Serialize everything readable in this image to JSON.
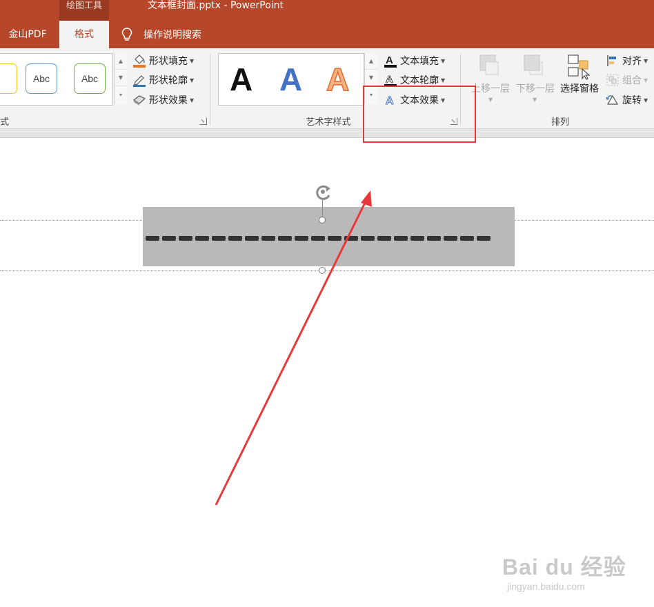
{
  "titlebar": {
    "context_tab_header": "绘图工具",
    "window_title": "文本框封面.pptx  -  PowerPoint"
  },
  "tabs": [
    {
      "label": "金山PDF"
    },
    {
      "label": "格式",
      "active": true
    }
  ],
  "tell_me": {
    "label": "操作说明搜索",
    "icon": "lightbulb-icon"
  },
  "ribbon": {
    "shape_styles": {
      "gallery_items": [
        {
          "label": "Abc",
          "outline": "#5b9bd5"
        },
        {
          "label": "Abc",
          "outline": "#70ad47"
        }
      ],
      "commands": [
        {
          "label": "形状填充",
          "icon": "paint-bucket-icon"
        },
        {
          "label": "形状轮廓",
          "icon": "pencil-outline-icon"
        },
        {
          "label": "形状效果",
          "icon": "shape-effects-icon"
        }
      ],
      "group_label_fragment": "式"
    },
    "wordart_styles": {
      "gallery_items": [
        {
          "label": "A",
          "color": "#111111"
        },
        {
          "label": "A",
          "color": "#4472c4"
        },
        {
          "label": "A",
          "color": "#f4b183"
        }
      ],
      "commands": [
        {
          "label": "文本填充",
          "icon": "text-fill-icon"
        },
        {
          "label": "文本轮廓",
          "icon": "text-outline-icon"
        },
        {
          "label": "文本效果",
          "icon": "text-effects-icon"
        }
      ],
      "group_label": "艺术字样式"
    },
    "arrange": {
      "large_buttons": [
        {
          "label": "上移一层",
          "enabled": false
        },
        {
          "label": "下移一层",
          "enabled": false
        },
        {
          "label": "选择窗格",
          "enabled": true
        }
      ],
      "commands": [
        {
          "label": "对齐",
          "enabled": true,
          "icon": "align-icon"
        },
        {
          "label": "组合",
          "enabled": false,
          "icon": "group-icon"
        },
        {
          "label": "旋转",
          "enabled": true,
          "icon": "rotate-icon"
        }
      ],
      "group_label": "排列"
    }
  },
  "slide": {
    "textbox_fill": "#b9b9b9",
    "dash_count": 21
  },
  "annotation": {
    "color": "#e8393a"
  },
  "watermark": {
    "brand": "Bai du 经验",
    "url": "jingyan.baidu.com"
  },
  "colors": {
    "accent": "#b7472a",
    "ribbon_bg": "#f3f3f3"
  }
}
